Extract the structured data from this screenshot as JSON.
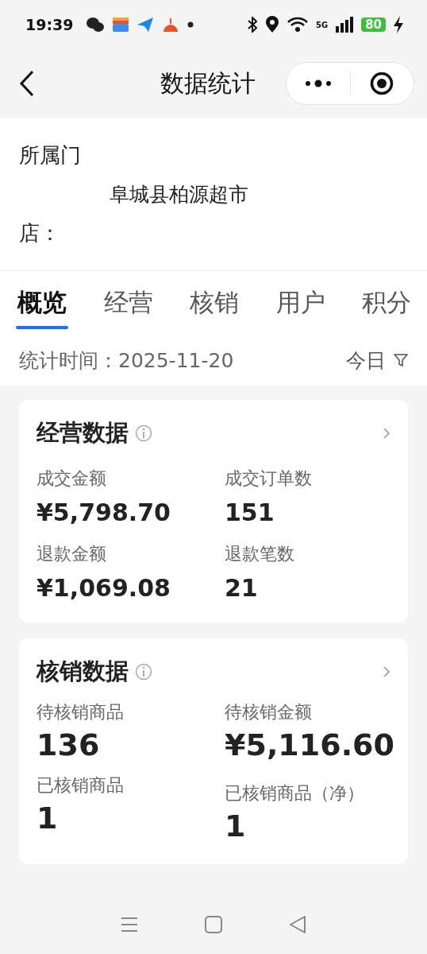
{
  "status_bar": {
    "time": "19:39",
    "network": "5G",
    "battery": "80"
  },
  "nav": {
    "title": "数据统计"
  },
  "store": {
    "label": "所属门店：",
    "value": "阜城县柏源超市"
  },
  "tabs": [
    {
      "label": "概览",
      "selected": true
    },
    {
      "label": "经营",
      "selected": false
    },
    {
      "label": "核销",
      "selected": false
    },
    {
      "label": "用户",
      "selected": false
    },
    {
      "label": "积分",
      "selected": false
    }
  ],
  "stat_period": {
    "label": "统计时间：2025-11-20",
    "range": "今日"
  },
  "cards": [
    {
      "title": "经营数据",
      "kind": "compact",
      "metrics": [
        {
          "label": "成交金额",
          "value": "¥5,798.70"
        },
        {
          "label": "成交订单数",
          "value": "151"
        },
        {
          "label": "退款金额",
          "value": "¥1,069.08"
        },
        {
          "label": "退款笔数",
          "value": "21"
        }
      ]
    },
    {
      "title": "核销数据",
      "kind": "large",
      "metrics": [
        {
          "label": "待核销商品",
          "value": "136"
        },
        {
          "label": "待核销金额",
          "value": "¥5,116.60"
        },
        {
          "label": "已核销商品",
          "value": "1"
        },
        {
          "label": "已核销商品（净）",
          "value": "1"
        }
      ]
    }
  ]
}
